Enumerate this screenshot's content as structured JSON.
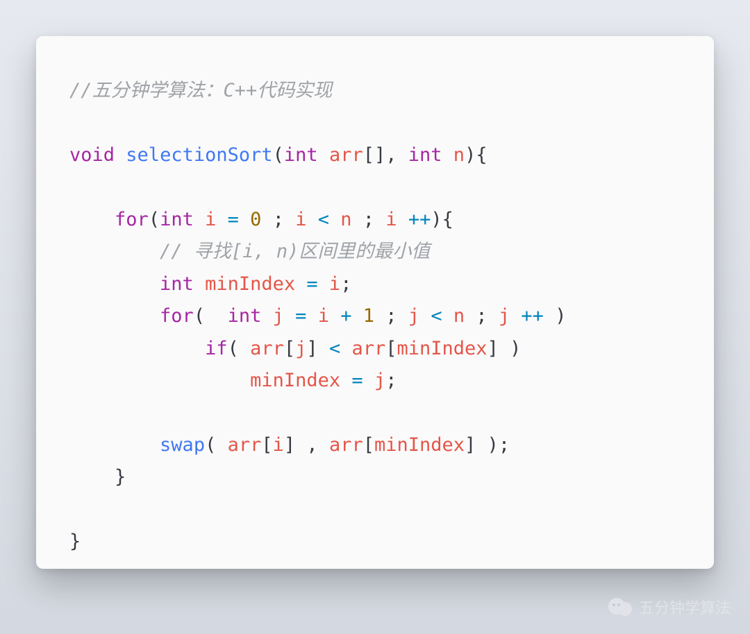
{
  "code": {
    "comment_top": "//五分钟学算法：C++代码实现",
    "kw_void": "void",
    "fn_name": "selectionSort",
    "sig_open": "(",
    "kw_int1": "int",
    "p_arr": "arr",
    "sig_brackets": "[]",
    "sig_comma": ", ",
    "kw_int2": "int",
    "p_n": "n",
    "sig_close": "){",
    "kw_for1": "for",
    "for1_open": "(",
    "kw_int3": "int",
    "p_i": "i",
    "op_eq1": " = ",
    "num_0": "0",
    "for1_sep1": " ; ",
    "for1_cond_lhs": "i",
    "op_lt1": " < ",
    "for1_cond_rhs": "n",
    "for1_sep2": " ; ",
    "for1_inc": "i",
    "op_pp1": " ++",
    "for1_close": "){",
    "comment_inner": "// 寻找[i, n)区间里的最小值",
    "kw_int4": "int",
    "p_minIndex": "minIndex",
    "op_eq2": " = ",
    "rhs_i": "i",
    "semi1": ";",
    "kw_for2": "for",
    "for2_open": "( ",
    "kw_int5": "int",
    "p_j": "j",
    "op_eq3": " = ",
    "rhs_i2": "i",
    "op_plus": " + ",
    "num_1": "1",
    "for2_sep1": " ; ",
    "for2_cond_lhs": "j",
    "op_lt2": " < ",
    "for2_cond_rhs": "n",
    "for2_sep2": " ; ",
    "for2_inc": "j",
    "op_pp2": " ++",
    "for2_close": " )",
    "kw_if": "if",
    "if_open": "( ",
    "if_arr1": "arr",
    "if_br1o": "[",
    "if_j": "j",
    "if_br1c": "]",
    "op_lt3": " < ",
    "if_arr2": "arr",
    "if_br2o": "[",
    "if_min": "minIndex",
    "if_br2c": "]",
    "if_close": " )",
    "assign_lhs": "minIndex",
    "op_eq4": " = ",
    "assign_rhs": "j",
    "semi2": ";",
    "fn_swap": "swap",
    "swap_open": "( ",
    "swap_arr1": "arr",
    "swap_br1o": "[",
    "swap_i": "i",
    "swap_br1c": "]",
    "swap_comma": " , ",
    "swap_arr2": "arr",
    "swap_br2o": "[",
    "swap_min": "minIndex",
    "swap_br2c": "]",
    "swap_close": " );",
    "brace_close1": "}",
    "brace_close2": "}"
  },
  "watermark": {
    "text": "五分钟学算法"
  }
}
